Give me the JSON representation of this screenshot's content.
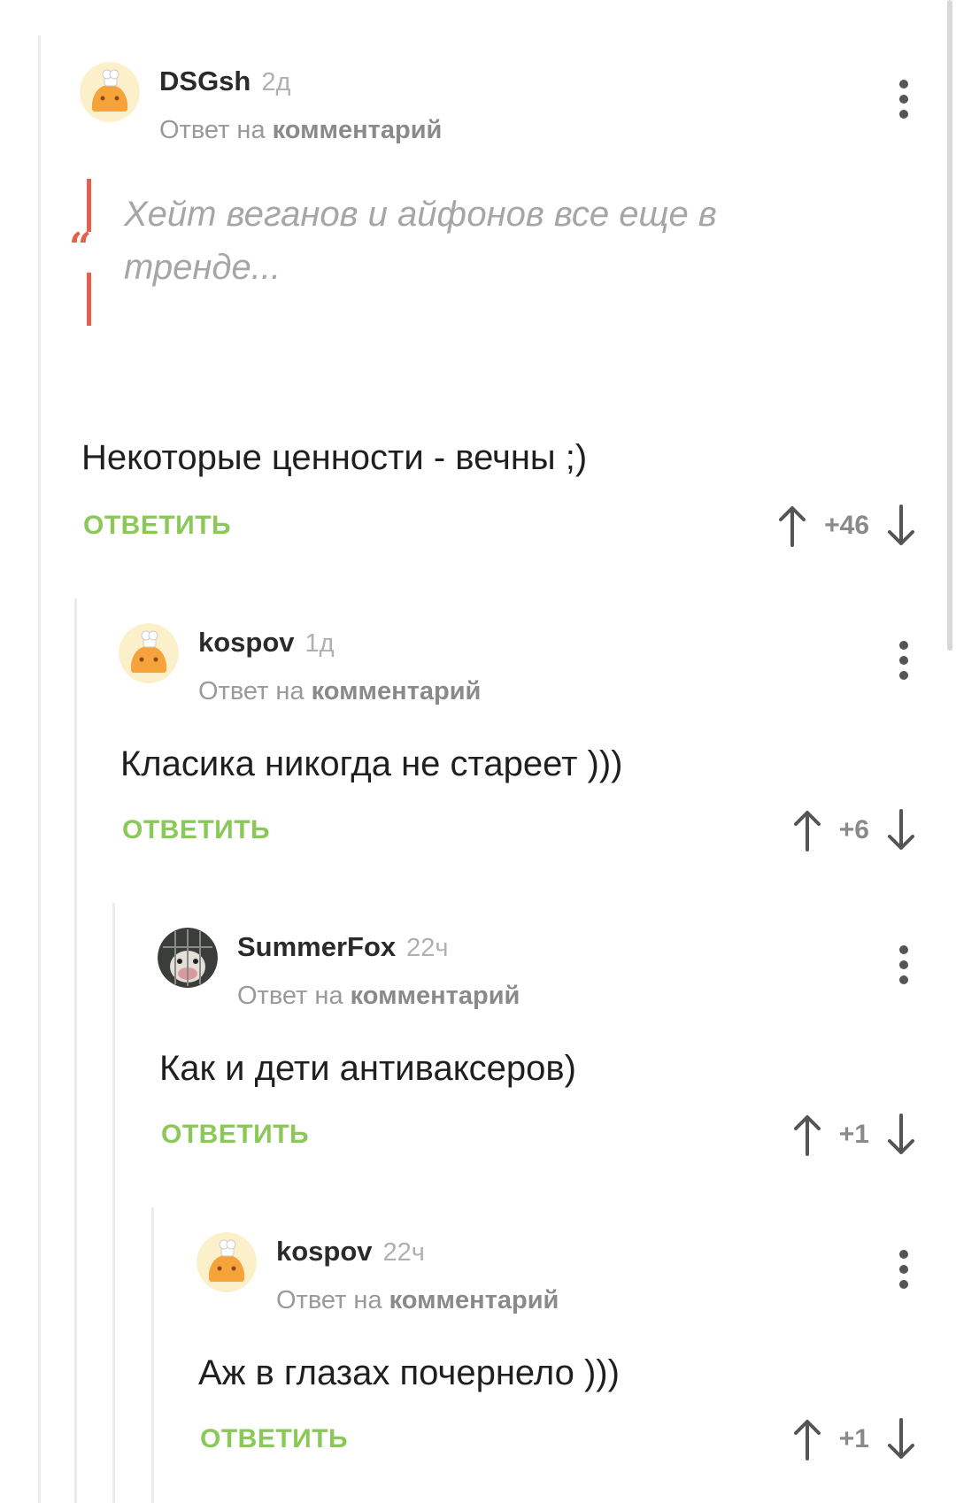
{
  "comments": [
    {
      "username": "DSGsh",
      "time": "2д",
      "reply_prefix": "Ответ на",
      "reply_target": "комментарий",
      "avatar_icon": "chef-avatar-icon",
      "quote": "Хейт веганов и айфонов все еще в тренде...",
      "text": "Некоторые ценности - вечны ;)",
      "reply_label": "ОТВЕТИТЬ",
      "score": "+46"
    },
    {
      "username": "kospov",
      "time": "1д",
      "reply_prefix": "Ответ на",
      "reply_target": "комментарий",
      "avatar_icon": "chef-avatar-icon",
      "text": "Класика никогда не стареет )))",
      "reply_label": "ОТВЕТИТЬ",
      "score": "+6"
    },
    {
      "username": "SummerFox",
      "time": "22ч",
      "reply_prefix": "Ответ на",
      "reply_target": "комментарий",
      "avatar_icon": "animal-photo-avatar-icon",
      "text": "Как и дети антиваксеров)",
      "reply_label": "ОТВЕТИТЬ",
      "score": "+1"
    },
    {
      "username": "kospov",
      "time": "22ч",
      "reply_prefix": "Ответ на",
      "reply_target": "комментарий",
      "avatar_icon": "chef-avatar-icon",
      "text": "Аж в глазах почернело )))",
      "reply_label": "ОТВЕТИТЬ",
      "score": "+1"
    }
  ],
  "colors": {
    "accent_green": "#8ac858",
    "quote_red": "#e5604c",
    "thread_line": "#ececec"
  }
}
